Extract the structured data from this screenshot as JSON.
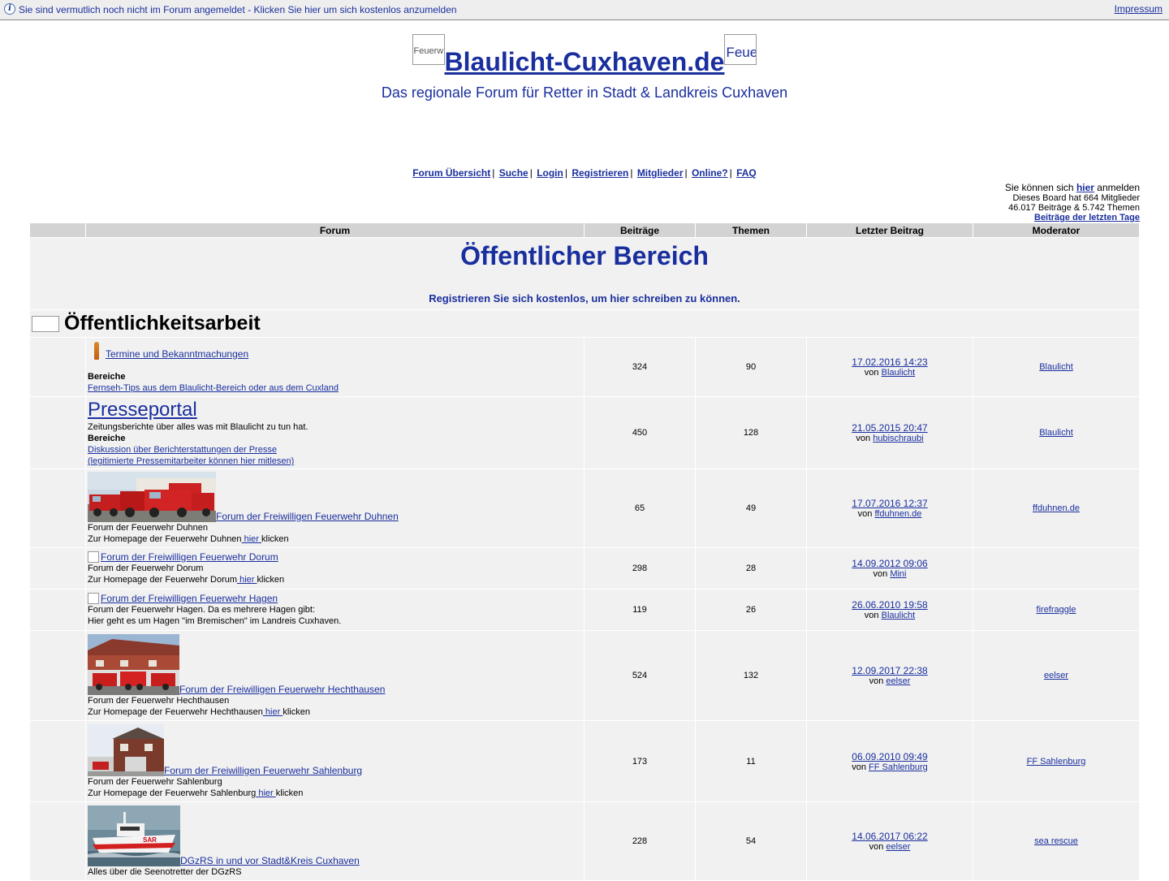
{
  "topbar": {
    "login_notice": "Sie sind vermutlich noch nicht im Forum angemeldet - Klicken Sie hier um sich kostenlos anzumelden",
    "impressum": "Impressum"
  },
  "header": {
    "title": "Blaulicht-Cuxhaven.de",
    "subtitle": "Das regionale Forum für Retter in Stadt & Landkreis Cuxhaven",
    "logo_left_alt": "Feuerw",
    "logo_right_alt": "Feue"
  },
  "nav": [
    "Forum Übersicht",
    "Suche",
    "Login",
    "Registrieren",
    "Mitglieder",
    "Online?",
    "FAQ"
  ],
  "stats": {
    "anmelden_pre": "Sie können sich ",
    "anmelden_link": "hier",
    "anmelden_post": " anmelden",
    "members": "Dieses Board hat 664 Mitglieder",
    "posts": "46.017 Beiträge & 5.742 Themen",
    "recent": "Beiträge der letzten Tage"
  },
  "table_headers": {
    "forum": "Forum",
    "posts": "Beiträge",
    "topics": "Themen",
    "last": "Letzter Beitrag",
    "moderator": "Moderator"
  },
  "category": {
    "title": "Öffentlicher Bereich",
    "note": "Registrieren Sie sich kostenlos, um hier schreiben zu können."
  },
  "section": {
    "title": "Öffentlichkeitsarbeit"
  },
  "by_label": "von",
  "here_label": " hier ",
  "click_label": "klicken",
  "areas_label": "Bereiche",
  "forums": [
    {
      "title": "Termine und Bekanntmachungen",
      "sub_forums": [
        "Fernseh-Tips aus dem Blaulicht-Bereich oder aus dem Cuxland"
      ],
      "posts": "324",
      "topics": "90",
      "last_date": "17.02.2016 14:23",
      "last_user": "Blaulicht",
      "moderator": "Blaulicht"
    },
    {
      "title": "Presseportal",
      "desc": "Zeitungsberichte über alles was mit Blaulicht zu tun hat.",
      "sub_forums": [
        "Diskussion über Berichterstattungen der Presse",
        "(legitimierte Pressemitarbeiter können hier mitlesen)"
      ],
      "posts": "450",
      "topics": "128",
      "last_date": "21.05.2015 20:47",
      "last_user": "hubischraubi",
      "moderator": "Blaulicht"
    },
    {
      "title": "Forum der Freiwilligen Feuerwehr Duhnen",
      "desc": "Forum der Feuerwehr Duhnen",
      "home_pre": "Zur Homepage der Feuerwehr Duhnen",
      "posts": "65",
      "topics": "49",
      "last_date": "17.07.2016 12:37",
      "last_user": "ffduhnen.de",
      "moderator": "ffduhnen.de"
    },
    {
      "title": "Forum der Freiwilligen Feuerwehr Dorum",
      "desc": "Forum der Feuerwehr Dorum",
      "home_pre": "Zur Homepage der Feuerwehr Dorum",
      "posts": "298",
      "topics": "28",
      "last_date": "14.09.2012 09:06",
      "last_user": "Mini",
      "moderator": ""
    },
    {
      "title": "Forum der Freiwilligen Feuerwehr Hagen",
      "desc": "Forum der Feuerwehr Hagen. Da es mehrere Hagen gibt:",
      "desc2": "Hier geht es um Hagen \"im Bremischen\" im Landreis Cuxhaven.",
      "posts": "119",
      "topics": "26",
      "last_date": "26.06.2010 19:58",
      "last_user": "Blaulicht",
      "moderator": "firefraggle"
    },
    {
      "title": "Forum der Freiwilligen Feuerwehr Hechthausen",
      "desc": "Forum der Feuerwehr Hechthausen",
      "home_pre": "Zur Homepage der Feuerwehr Hechthausen",
      "posts": "524",
      "topics": "132",
      "last_date": "12.09.2017 22:38",
      "last_user": "eelser",
      "moderator": "eelser"
    },
    {
      "title": "Forum der Freiwilligen Feuerwehr Sahlenburg",
      "desc": "Forum der Feuerwehr Sahlenburg",
      "home_pre": "Zur Homepage der Feuerwehr Sahlenburg",
      "posts": "173",
      "topics": "11",
      "last_date": "06.09.2010 09:49",
      "last_user": "FF Sahlenburg",
      "moderator": "FF Sahlenburg"
    },
    {
      "title": "DGzRS in und vor Stadt&Kreis Cuxhaven",
      "desc": "Alles über die Seenotretter der DGzRS",
      "posts": "228",
      "topics": "54",
      "last_date": "14.06.2017 06:22",
      "last_user": "eelser",
      "moderator": "sea rescue"
    }
  ],
  "colors": {
    "link": "#1a2f9e",
    "header_bg": "#d3d3d3",
    "row_bg": "#f1f1f1"
  },
  "images": {
    "boat_label": "SAR"
  }
}
